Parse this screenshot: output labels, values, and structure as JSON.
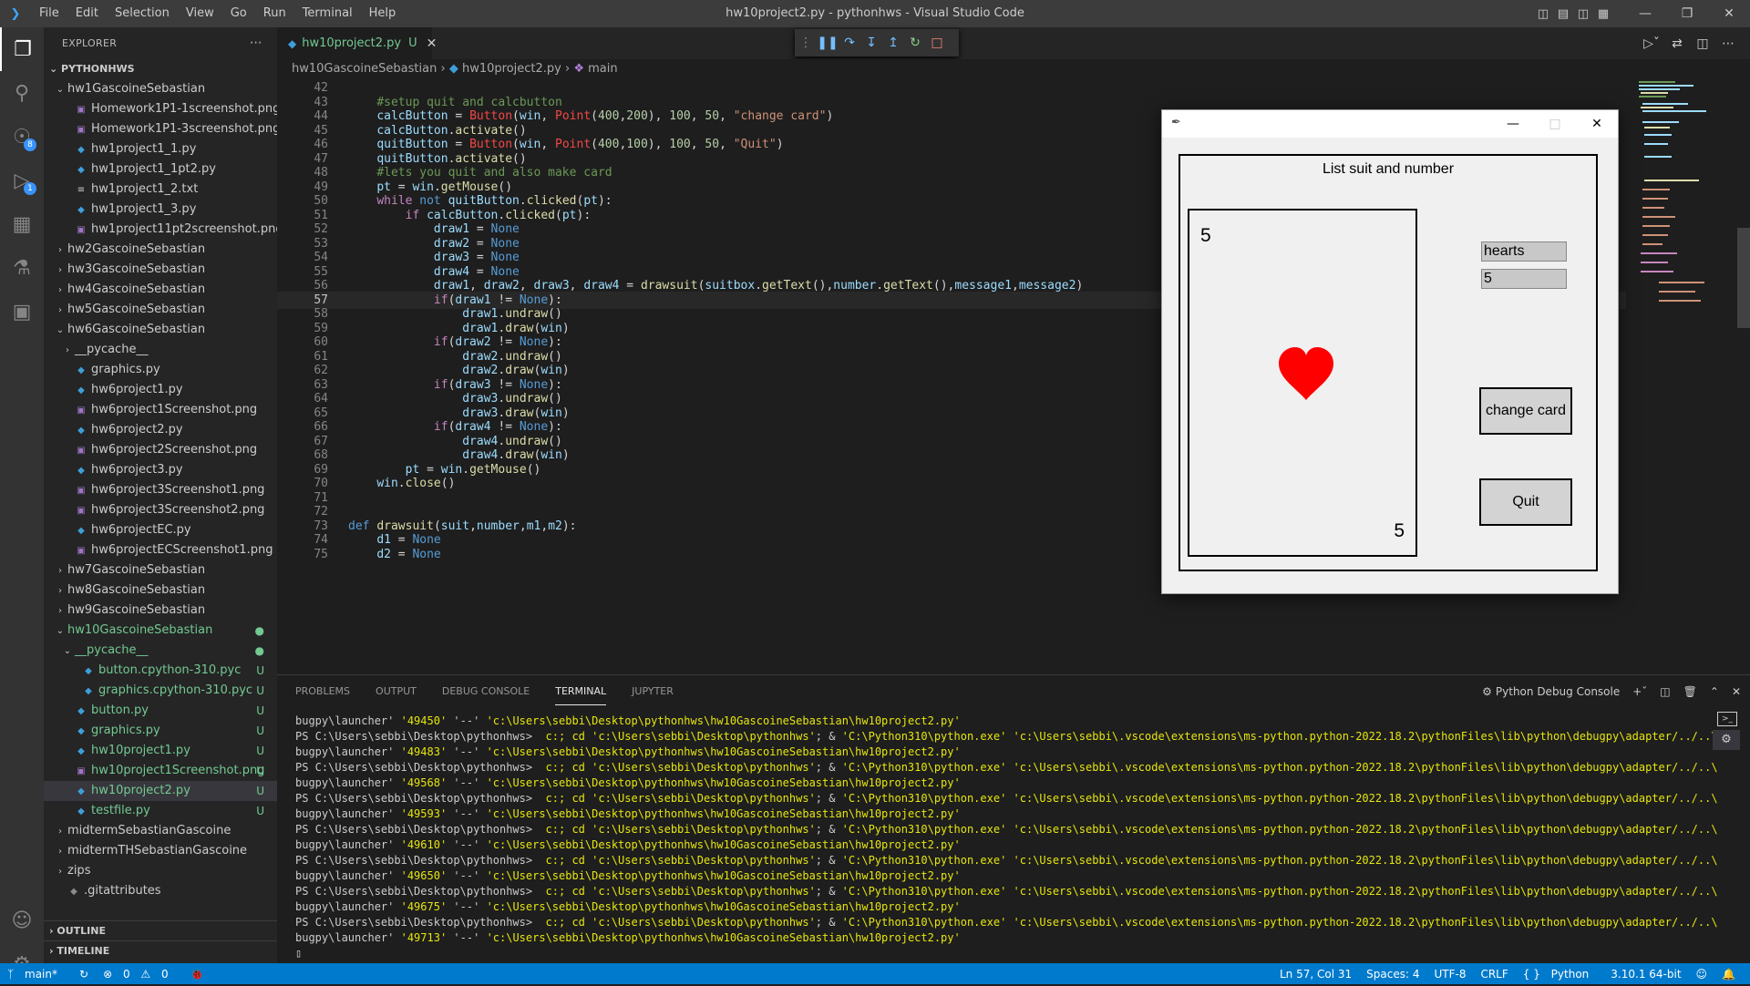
{
  "titlebar": {
    "menu": [
      "File",
      "Edit",
      "Selection",
      "View",
      "Go",
      "Run",
      "Terminal",
      "Help"
    ],
    "title": "hw10project2.py - pythonhws - Visual Studio Code"
  },
  "explorer": {
    "header": "EXPLORER",
    "root": "PYTHONHWS",
    "items": [
      {
        "label": "hw1GascoineSebastian",
        "type": "folder-open",
        "indent": 1
      },
      {
        "label": "Homework1P1-1screenshot.png",
        "type": "png",
        "indent": 2
      },
      {
        "label": "Homework1P1-3screenshot.png",
        "type": "png",
        "indent": 2
      },
      {
        "label": "hw1project1_1.py",
        "type": "py",
        "indent": 2
      },
      {
        "label": "hw1project1_1pt2.py",
        "type": "py",
        "indent": 2
      },
      {
        "label": "hw1project1_2.txt",
        "type": "txt",
        "indent": 2
      },
      {
        "label": "hw1project1_3.py",
        "type": "py",
        "indent": 2
      },
      {
        "label": "hw1project11pt2screenshot.png",
        "type": "png",
        "indent": 2
      },
      {
        "label": "hw2GascoineSebastian",
        "type": "folder",
        "indent": 1
      },
      {
        "label": "hw3GascoineSebastian",
        "type": "folder",
        "indent": 1
      },
      {
        "label": "hw4GascoineSebastian",
        "type": "folder",
        "indent": 1
      },
      {
        "label": "hw5GascoineSebastian",
        "type": "folder",
        "indent": 1
      },
      {
        "label": "hw6GascoineSebastian",
        "type": "folder-open",
        "indent": 1
      },
      {
        "label": "__pycache__",
        "type": "folder",
        "indent": 2
      },
      {
        "label": "graphics.py",
        "type": "py",
        "indent": 2
      },
      {
        "label": "hw6project1.py",
        "type": "py",
        "indent": 2
      },
      {
        "label": "hw6project1Screenshot.png",
        "type": "png",
        "indent": 2
      },
      {
        "label": "hw6project2.py",
        "type": "py",
        "indent": 2
      },
      {
        "label": "hw6project2Screenshot.png",
        "type": "png",
        "indent": 2
      },
      {
        "label": "hw6project3.py",
        "type": "py",
        "indent": 2
      },
      {
        "label": "hw6project3Screenshot1.png",
        "type": "png",
        "indent": 2
      },
      {
        "label": "hw6project3Screenshot2.png",
        "type": "png",
        "indent": 2
      },
      {
        "label": "hw6projectEC.py",
        "type": "py",
        "indent": 2
      },
      {
        "label": "hw6projectECScreenshot1.png",
        "type": "png",
        "indent": 2
      },
      {
        "label": "hw7GascoineSebastian",
        "type": "folder",
        "indent": 1
      },
      {
        "label": "hw8GascoineSebastian",
        "type": "folder",
        "indent": 1
      },
      {
        "label": "hw9GascoineSebastian",
        "type": "folder",
        "indent": 1
      },
      {
        "label": "hw10GascoineSebastian",
        "type": "folder-open",
        "indent": 1,
        "green": true,
        "status": "●"
      },
      {
        "label": "__pycache__",
        "type": "folder-open",
        "indent": 2,
        "green": true,
        "status": "●"
      },
      {
        "label": "button.cpython-310.pyc",
        "type": "pyc",
        "indent": 3,
        "green": true,
        "status": "U"
      },
      {
        "label": "graphics.cpython-310.pyc",
        "type": "pyc",
        "indent": 3,
        "green": true,
        "status": "U"
      },
      {
        "label": "button.py",
        "type": "py",
        "indent": 2,
        "green": true,
        "status": "U"
      },
      {
        "label": "graphics.py",
        "type": "py",
        "indent": 2,
        "green": true,
        "status": "U"
      },
      {
        "label": "hw10project1.py",
        "type": "py",
        "indent": 2,
        "green": true,
        "status": "U"
      },
      {
        "label": "hw10project1Screenshot.png",
        "type": "png",
        "indent": 2,
        "green": true,
        "status": "U"
      },
      {
        "label": "hw10project2.py",
        "type": "py",
        "indent": 2,
        "green": true,
        "status": "U",
        "selected": true
      },
      {
        "label": "testfile.py",
        "type": "py",
        "indent": 2,
        "green": true,
        "status": "U"
      },
      {
        "label": "midtermSebastianGascoine",
        "type": "folder",
        "indent": 1
      },
      {
        "label": "midtermTHSebastianGascoine",
        "type": "folder",
        "indent": 1
      },
      {
        "label": "zips",
        "type": "folder",
        "indent": 1
      },
      {
        "label": ".gitattributes",
        "type": "git",
        "indent": 1
      }
    ],
    "outline": "OUTLINE",
    "timeline": "TIMELINE"
  },
  "tab": {
    "name": "hw10project2.py",
    "status": "U"
  },
  "breadcrumb": {
    "folder": "hw10GascoineSebastian",
    "file": "hw10project2.py",
    "symbol": "main"
  },
  "code": {
    "current_line": 57,
    "lines": [
      {
        "n": "42",
        "html": ""
      },
      {
        "n": "43",
        "html": "    <span class='tok-c'>#setup quit and calcbutton</span>"
      },
      {
        "n": "44",
        "html": "    <span class='tok-v'>calcButton</span> <span class='tok-p'>=</span> <span class='tok-r'>Button</span><span class='tok-p'>(</span><span class='tok-v'>win</span><span class='tok-p'>, </span><span class='tok-r'>Point</span><span class='tok-p'>(</span><span class='tok-n'>400</span><span class='tok-p'>,</span><span class='tok-n'>200</span><span class='tok-p'>), </span><span class='tok-n'>100</span><span class='tok-p'>, </span><span class='tok-n'>50</span><span class='tok-p'>, </span><span class='tok-s'>\"change card\"</span><span class='tok-p'>)</span>"
      },
      {
        "n": "45",
        "html": "    <span class='tok-v'>calcButton</span><span class='tok-p'>.</span><span class='tok-f'>activate</span><span class='tok-p'>()</span>"
      },
      {
        "n": "46",
        "html": "    <span class='tok-v'>quitButton</span> <span class='tok-p'>=</span> <span class='tok-r'>Button</span><span class='tok-p'>(</span><span class='tok-v'>win</span><span class='tok-p'>, </span><span class='tok-r'>Point</span><span class='tok-p'>(</span><span class='tok-n'>400</span><span class='tok-p'>,</span><span class='tok-n'>100</span><span class='tok-p'>), </span><span class='tok-n'>100</span><span class='tok-p'>, </span><span class='tok-n'>50</span><span class='tok-p'>, </span><span class='tok-s'>\"Quit\"</span><span class='tok-p'>)</span>"
      },
      {
        "n": "47",
        "html": "    <span class='tok-v'>quitButton</span><span class='tok-p'>.</span><span class='tok-f'>activate</span><span class='tok-p'>()</span>"
      },
      {
        "n": "48",
        "html": "    <span class='tok-c'>#lets you quit and also make card</span>"
      },
      {
        "n": "49",
        "html": "    <span class='tok-v'>pt</span> <span class='tok-p'>=</span> <span class='tok-v'>win</span><span class='tok-p'>.</span><span class='tok-f'>getMouse</span><span class='tok-p'>()</span>"
      },
      {
        "n": "50",
        "html": "    <span class='tok-k'>while</span> <span class='tok-d'>not</span> <span class='tok-v'>quitButton</span><span class='tok-p'>.</span><span class='tok-f'>clicked</span><span class='tok-p'>(</span><span class='tok-v'>pt</span><span class='tok-p'>):</span>"
      },
      {
        "n": "51",
        "html": "        <span class='tok-k'>if</span> <span class='tok-v'>calcButton</span><span class='tok-p'>.</span><span class='tok-f'>clicked</span><span class='tok-p'>(</span><span class='tok-v'>pt</span><span class='tok-p'>):</span>"
      },
      {
        "n": "52",
        "html": "            <span class='tok-v'>draw1</span> <span class='tok-p'>=</span> <span class='tok-d'>None</span>"
      },
      {
        "n": "53",
        "html": "            <span class='tok-v'>draw2</span> <span class='tok-p'>=</span> <span class='tok-d'>None</span>"
      },
      {
        "n": "54",
        "html": "            <span class='tok-v'>draw3</span> <span class='tok-p'>=</span> <span class='tok-d'>None</span>"
      },
      {
        "n": "55",
        "html": "            <span class='tok-v'>draw4</span> <span class='tok-p'>=</span> <span class='tok-d'>None</span>"
      },
      {
        "n": "56",
        "html": "            <span class='tok-v'>draw1</span><span class='tok-p'>, </span><span class='tok-v'>draw2</span><span class='tok-p'>, </span><span class='tok-v'>draw3</span><span class='tok-p'>, </span><span class='tok-v'>draw4</span> <span class='tok-p'>=</span> <span class='tok-f'>drawsuit</span><span class='tok-p'>(</span><span class='tok-v'>suitbox</span><span class='tok-p'>.</span><span class='tok-f'>getText</span><span class='tok-p'>(),</span><span class='tok-v'>number</span><span class='tok-p'>.</span><span class='tok-f'>getText</span><span class='tok-p'>(),</span><span class='tok-v'>message1</span><span class='tok-p'>,</span><span class='tok-v'>message2</span><span class='tok-p'>)</span>"
      },
      {
        "n": "57",
        "html": "            <span class='tok-k'>if</span><span class='tok-p'>(</span><span class='tok-v'>draw1</span> <span class='tok-p'>!=</span> <span class='tok-d'>None</span><span class='tok-p'>):</span>"
      },
      {
        "n": "58",
        "html": "                <span class='tok-v'>draw1</span><span class='tok-p'>.</span><span class='tok-f'>undraw</span><span class='tok-p'>()</span>"
      },
      {
        "n": "59",
        "html": "                <span class='tok-v'>draw1</span><span class='tok-p'>.</span><span class='tok-f'>draw</span><span class='tok-p'>(</span><span class='tok-v'>win</span><span class='tok-p'>)</span>"
      },
      {
        "n": "60",
        "html": "            <span class='tok-k'>if</span><span class='tok-p'>(</span><span class='tok-v'>draw2</span> <span class='tok-p'>!=</span> <span class='tok-d'>None</span><span class='tok-p'>):</span>"
      },
      {
        "n": "61",
        "html": "                <span class='tok-v'>draw2</span><span class='tok-p'>.</span><span class='tok-f'>undraw</span><span class='tok-p'>()</span>"
      },
      {
        "n": "62",
        "html": "                <span class='tok-v'>draw2</span><span class='tok-p'>.</span><span class='tok-f'>draw</span><span class='tok-p'>(</span><span class='tok-v'>win</span><span class='tok-p'>)</span>"
      },
      {
        "n": "63",
        "html": "            <span class='tok-k'>if</span><span class='tok-p'>(</span><span class='tok-v'>draw3</span> <span class='tok-p'>!=</span> <span class='tok-d'>None</span><span class='tok-p'>):</span>"
      },
      {
        "n": "64",
        "html": "                <span class='tok-v'>draw3</span><span class='tok-p'>.</span><span class='tok-f'>undraw</span><span class='tok-p'>()</span>"
      },
      {
        "n": "65",
        "html": "                <span class='tok-v'>draw3</span><span class='tok-p'>.</span><span class='tok-f'>draw</span><span class='tok-p'>(</span><span class='tok-v'>win</span><span class='tok-p'>)</span>"
      },
      {
        "n": "66",
        "html": "            <span class='tok-k'>if</span><span class='tok-p'>(</span><span class='tok-v'>draw4</span> <span class='tok-p'>!=</span> <span class='tok-d'>None</span><span class='tok-p'>):</span>"
      },
      {
        "n": "67",
        "html": "                <span class='tok-v'>draw4</span><span class='tok-p'>.</span><span class='tok-f'>undraw</span><span class='tok-p'>()</span>"
      },
      {
        "n": "68",
        "html": "                <span class='tok-v'>draw4</span><span class='tok-p'>.</span><span class='tok-f'>draw</span><span class='tok-p'>(</span><span class='tok-v'>win</span><span class='tok-p'>)</span>"
      },
      {
        "n": "69",
        "html": "        <span class='tok-v'>pt</span> <span class='tok-p'>=</span> <span class='tok-v'>win</span><span class='tok-p'>.</span><span class='tok-f'>getMouse</span><span class='tok-p'>()</span>"
      },
      {
        "n": "70",
        "html": "    <span class='tok-v'>win</span><span class='tok-p'>.</span><span class='tok-f'>close</span><span class='tok-p'>()</span>"
      },
      {
        "n": "71",
        "html": ""
      },
      {
        "n": "72",
        "html": ""
      },
      {
        "n": "73",
        "html": "<span class='tok-d'>def</span> <span class='tok-f'>drawsuit</span><span class='tok-p'>(</span><span class='tok-v'>suit</span><span class='tok-p'>,</span><span class='tok-v'>number</span><span class='tok-p'>,</span><span class='tok-v'>m1</span><span class='tok-p'>,</span><span class='tok-v'>m2</span><span class='tok-p'>):</span>"
      },
      {
        "n": "74",
        "html": "    <span class='tok-v'>d1</span> <span class='tok-p'>=</span> <span class='tok-d'>None</span>"
      },
      {
        "n": "75",
        "html": "    <span class='tok-v'>d2</span> <span class='tok-p'>=</span> <span class='tok-d'>None</span>"
      }
    ]
  },
  "panel": {
    "tabs": [
      "PROBLEMS",
      "OUTPUT",
      "DEBUG CONSOLE",
      "TERMINAL",
      "JUPYTER"
    ],
    "active_tab": "TERMINAL",
    "console_name": "Python Debug Console",
    "prompt": "PS C:\\Users\\sebbi\\Desktop\\pythonhws>",
    "cmd_part1": " c:; cd ",
    "cd_path": "'c:\\Users\\sebbi\\Desktop\\pythonhws'",
    "cmd_part2": "; & ",
    "python_exe": "'C:\\Python310\\python.exe'",
    "adapter_path": "'c:\\Users\\sebbi\\.vscode\\extensions\\ms-python.python-2022.18.2\\pythonFiles\\lib\\python\\debugpy\\adapter/../..\\de",
    "launcher": "bugpy\\launcher'",
    "dashes": "'--'",
    "script_path": "'c:\\Users\\sebbi\\Desktop\\pythonhws\\hw10GascoineSebastian\\hw10project2.py'",
    "ports": [
      "'49450'",
      "'49483'",
      "'49568'",
      "'49593'",
      "'49610'",
      "'49650'",
      "'49675'",
      "'49713'"
    ]
  },
  "statusbar": {
    "branch": "main*",
    "errors": "0",
    "warnings": "0",
    "position": "Ln 57, Col 31",
    "spaces": "Spaces: 4",
    "encoding": "UTF-8",
    "eol": "CRLF",
    "language": "Python",
    "interpreter": "3.10.1 64-bit"
  },
  "graphics_window": {
    "title": "List suit and number",
    "card_rank_top": "5",
    "card_rank_bottom": "5",
    "suit_entry": "hearts",
    "number_entry": "5",
    "change_card_label": "change card",
    "quit_label": "Quit",
    "heart_color": "#ff0000"
  },
  "colors": {
    "accent": "#007acc",
    "git_untracked": "#73c991"
  }
}
